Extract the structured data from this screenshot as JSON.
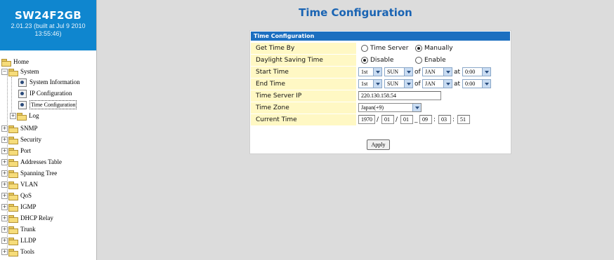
{
  "brand": {
    "model": "SW24F2GB",
    "version": "2.01.23 (built at Jul 9 2010",
    "time": "13:55:46)",
    "color": "#0f86cf"
  },
  "tree": {
    "home": "Home",
    "system": "System",
    "system_items": [
      "System Information",
      "IP Configuration",
      "Time Configuration"
    ],
    "log": "Log",
    "items": [
      "SNMP",
      "Security",
      "Port",
      "Addresses Table",
      "Spanning Tree",
      "VLAN",
      "QoS",
      "IGMP",
      "DHCP Relay",
      "Trunk",
      "LLDP",
      "Tools"
    ]
  },
  "page": {
    "title": "Time Configuration",
    "title_color": "#1a64b3"
  },
  "panel": {
    "header": "Time Configuration",
    "header_color": "#1c6fc0",
    "label_bg": "#fff8c4",
    "rows": {
      "get_time_by": {
        "label": "Get Time By",
        "opt1": "Time Server",
        "opt2": "Manually",
        "selected": "Manually"
      },
      "dst": {
        "label": "Daylight Saving Time",
        "opt1": "Disable",
        "opt2": "Enable",
        "selected": "Disable"
      },
      "start": {
        "label": "Start Time",
        "week": "1st",
        "day": "SUN",
        "of": "of",
        "month": "JAN",
        "at": "at",
        "time": "0:00"
      },
      "end": {
        "label": "End Time",
        "week": "1st",
        "day": "SUN",
        "of": "of",
        "month": "JAN",
        "at": "at",
        "time": "0:00"
      },
      "server_ip": {
        "label": "Time Server IP",
        "value": "220.130.158.54"
      },
      "zone": {
        "label": "Time Zone",
        "value": "Japan(+9)"
      },
      "current": {
        "label": "Current Time",
        "year": "1970",
        "month": "01",
        "day": "01",
        "hour": "09",
        "minute": "03",
        "second": "51",
        "sep_date": "/",
        "sep_mid": "_",
        "sep_time": ":"
      }
    },
    "apply_label": "Apply"
  }
}
